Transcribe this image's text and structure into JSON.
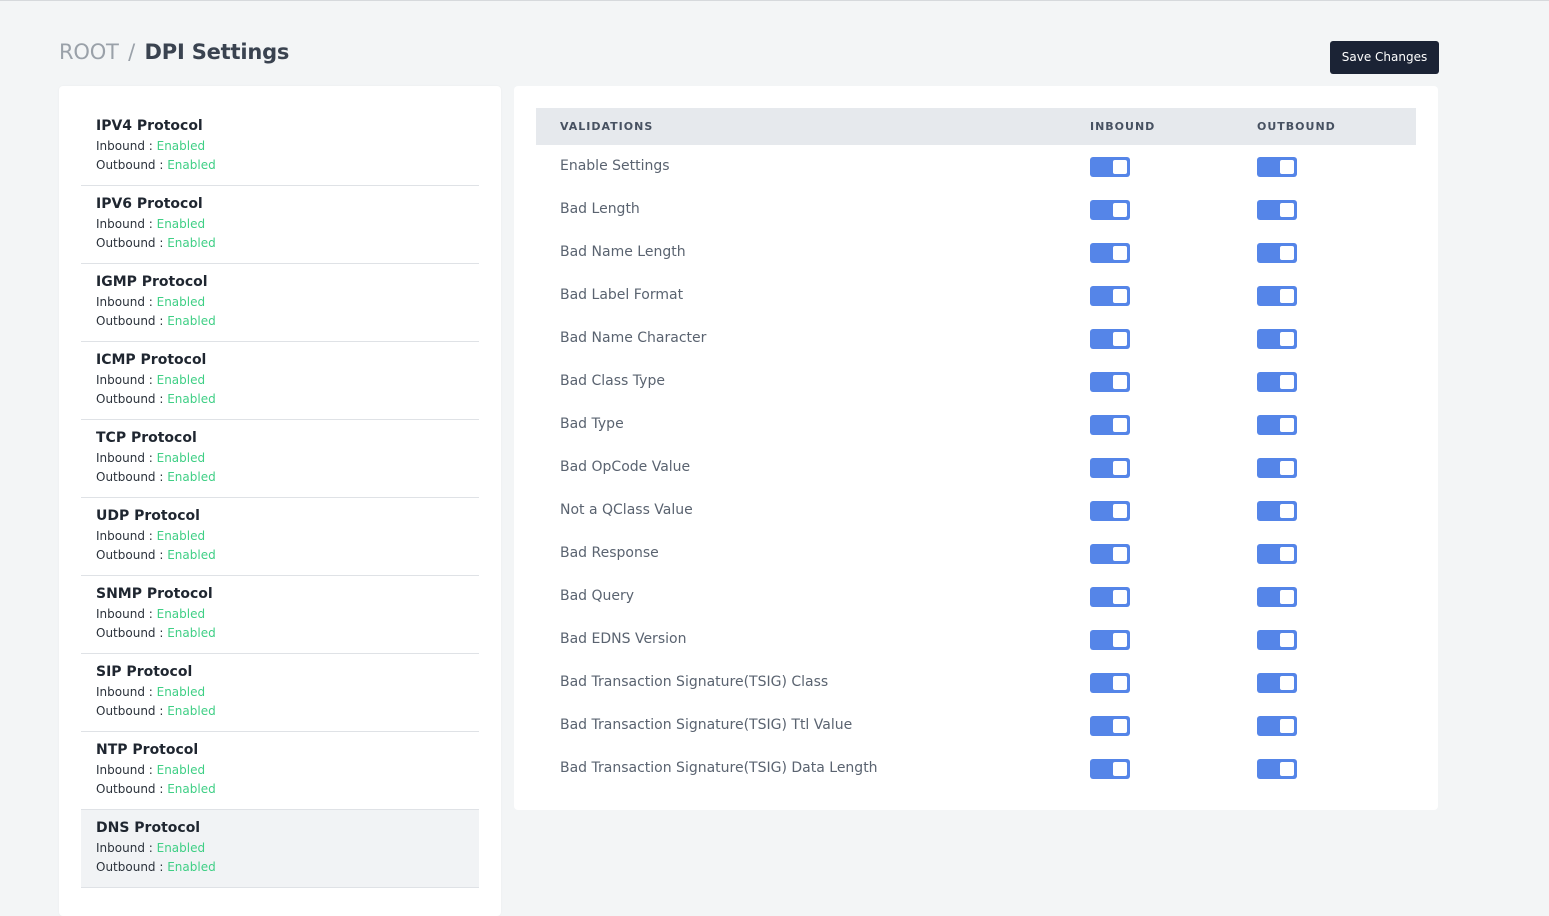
{
  "header": {
    "breadcrumb_root": "ROOT",
    "breadcrumb_separator": "/",
    "breadcrumb_current": "DPI Settings",
    "save_label": "Save Changes"
  },
  "protocols": [
    {
      "name": "IPV4 Protocol",
      "inbound_label": "Inbound",
      "inbound_status": "Enabled",
      "outbound_label": "Outbound",
      "outbound_status": "Enabled"
    },
    {
      "name": "IPV6 Protocol",
      "inbound_label": "Inbound",
      "inbound_status": "Enabled",
      "outbound_label": "Outbound",
      "outbound_status": "Enabled"
    },
    {
      "name": "IGMP Protocol",
      "inbound_label": "Inbound",
      "inbound_status": "Enabled",
      "outbound_label": "Outbound",
      "outbound_status": "Enabled"
    },
    {
      "name": "ICMP Protocol",
      "inbound_label": "Inbound",
      "inbound_status": "Enabled",
      "outbound_label": "Outbound",
      "outbound_status": "Enabled"
    },
    {
      "name": "TCP Protocol",
      "inbound_label": "Inbound",
      "inbound_status": "Enabled",
      "outbound_label": "Outbound",
      "outbound_status": "Enabled"
    },
    {
      "name": "UDP Protocol",
      "inbound_label": "Inbound",
      "inbound_status": "Enabled",
      "outbound_label": "Outbound",
      "outbound_status": "Enabled"
    },
    {
      "name": "SNMP Protocol",
      "inbound_label": "Inbound",
      "inbound_status": "Enabled",
      "outbound_label": "Outbound",
      "outbound_status": "Enabled"
    },
    {
      "name": "SIP Protocol",
      "inbound_label": "Inbound",
      "inbound_status": "Enabled",
      "outbound_label": "Outbound",
      "outbound_status": "Enabled"
    },
    {
      "name": "NTP Protocol",
      "inbound_label": "Inbound",
      "inbound_status": "Enabled",
      "outbound_label": "Outbound",
      "outbound_status": "Enabled"
    },
    {
      "name": "DNS Protocol",
      "inbound_label": "Inbound",
      "inbound_status": "Enabled",
      "outbound_label": "Outbound",
      "outbound_status": "Enabled",
      "selected": true
    }
  ],
  "validations": {
    "columns": {
      "validations": "VALIDATIONS",
      "inbound": "INBOUND",
      "outbound": "OUTBOUND"
    },
    "rows": [
      {
        "label": "Enable Settings",
        "inbound": true,
        "outbound": true
      },
      {
        "label": "Bad Length",
        "inbound": true,
        "outbound": true
      },
      {
        "label": "Bad Name Length",
        "inbound": true,
        "outbound": true
      },
      {
        "label": "Bad Label Format",
        "inbound": true,
        "outbound": true
      },
      {
        "label": "Bad Name Character",
        "inbound": true,
        "outbound": true
      },
      {
        "label": "Bad Class Type",
        "inbound": true,
        "outbound": true
      },
      {
        "label": "Bad Type",
        "inbound": true,
        "outbound": true
      },
      {
        "label": "Bad OpCode Value",
        "inbound": true,
        "outbound": true
      },
      {
        "label": "Not a QClass Value",
        "inbound": true,
        "outbound": true
      },
      {
        "label": "Bad Response",
        "inbound": true,
        "outbound": true
      },
      {
        "label": "Bad Query",
        "inbound": true,
        "outbound": true
      },
      {
        "label": "Bad EDNS Version",
        "inbound": true,
        "outbound": true
      },
      {
        "label": "Bad Transaction Signature(TSIG) Class",
        "inbound": true,
        "outbound": true
      },
      {
        "label": "Bad Transaction Signature(TSIG) Ttl Value",
        "inbound": true,
        "outbound": true
      },
      {
        "label": "Bad Transaction Signature(TSIG) Data Length",
        "inbound": true,
        "outbound": true
      }
    ]
  },
  "colors": {
    "accent_toggle": "#5585e8",
    "status_enabled": "#3fcf85",
    "save_button": "#1b2335"
  }
}
